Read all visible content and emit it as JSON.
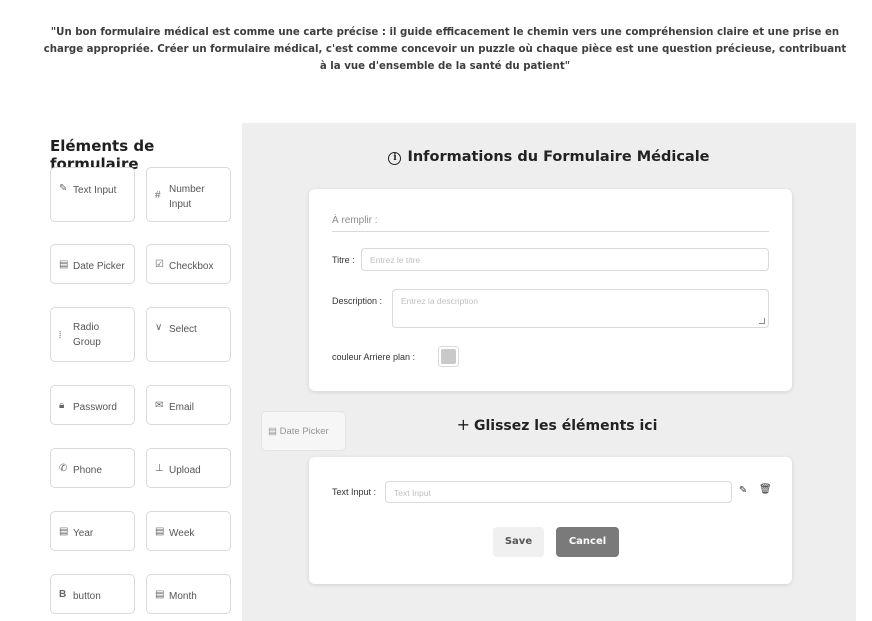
{
  "quote": "\"Un bon formulaire médical est comme une carte précise : il guide efficacement le chemin vers une compréhension claire et une prise en charge appropriée. Créer un formulaire médical, c'est comme concevoir un puzzle où chaque pièce est une question précieuse, contribuant à la vue d'ensemble de la santé du patient\"",
  "sidebar": {
    "title": "Eléments de formulaire",
    "items": [
      {
        "label": "Text Input",
        "icon": "edit-icon",
        "glyph": "✎"
      },
      {
        "label": "Number Input",
        "icon": "hash-icon",
        "glyph": "#"
      },
      {
        "label": "Date Picker",
        "icon": "calendar-icon",
        "glyph": "▤"
      },
      {
        "label": "Checkbox",
        "icon": "checkbox-icon",
        "glyph": "☑"
      },
      {
        "label": "Radio Group",
        "icon": "radio-icon",
        "glyph": "⦙"
      },
      {
        "label": "Select",
        "icon": "chevron-down-icon",
        "glyph": "∨"
      },
      {
        "label": "Password",
        "icon": "lock-icon",
        "glyph": "🔒︎"
      },
      {
        "label": "Email",
        "icon": "mail-icon",
        "glyph": "✉"
      },
      {
        "label": "Phone",
        "icon": "phone-icon",
        "glyph": "✆"
      },
      {
        "label": "Upload",
        "icon": "upload-icon",
        "glyph": "⊥"
      },
      {
        "label": "Year",
        "icon": "calendar-icon",
        "glyph": "▤"
      },
      {
        "label": "Week",
        "icon": "calendar-icon",
        "glyph": "▤"
      },
      {
        "label": "button",
        "icon": "bold-icon",
        "glyph": "B"
      },
      {
        "label": "Month",
        "icon": "calendar-icon",
        "glyph": "▤"
      }
    ]
  },
  "form_info": {
    "title": "Informations du Formulaire Médicale",
    "info_glyph": "i",
    "fill_label": "À remplir :",
    "titre_label": "Titre :",
    "titre_placeholder": "Entrez le titre",
    "description_label": "Description :",
    "description_placeholder": "Entrez la description",
    "bg_color_label": "couleur Arriere plan :",
    "bg_color_value": "#c9c9c9"
  },
  "drop_zone": {
    "title": "Glissez les éléments ici",
    "move_glyph": "+",
    "dragging_item": "Date Picker",
    "field_label": "Text Input :",
    "field_placeholder": "Text Input",
    "edit_glyph": "✎",
    "delete_glyph": "🗑︎",
    "save_label": "Save",
    "cancel_label": "Cancel"
  }
}
